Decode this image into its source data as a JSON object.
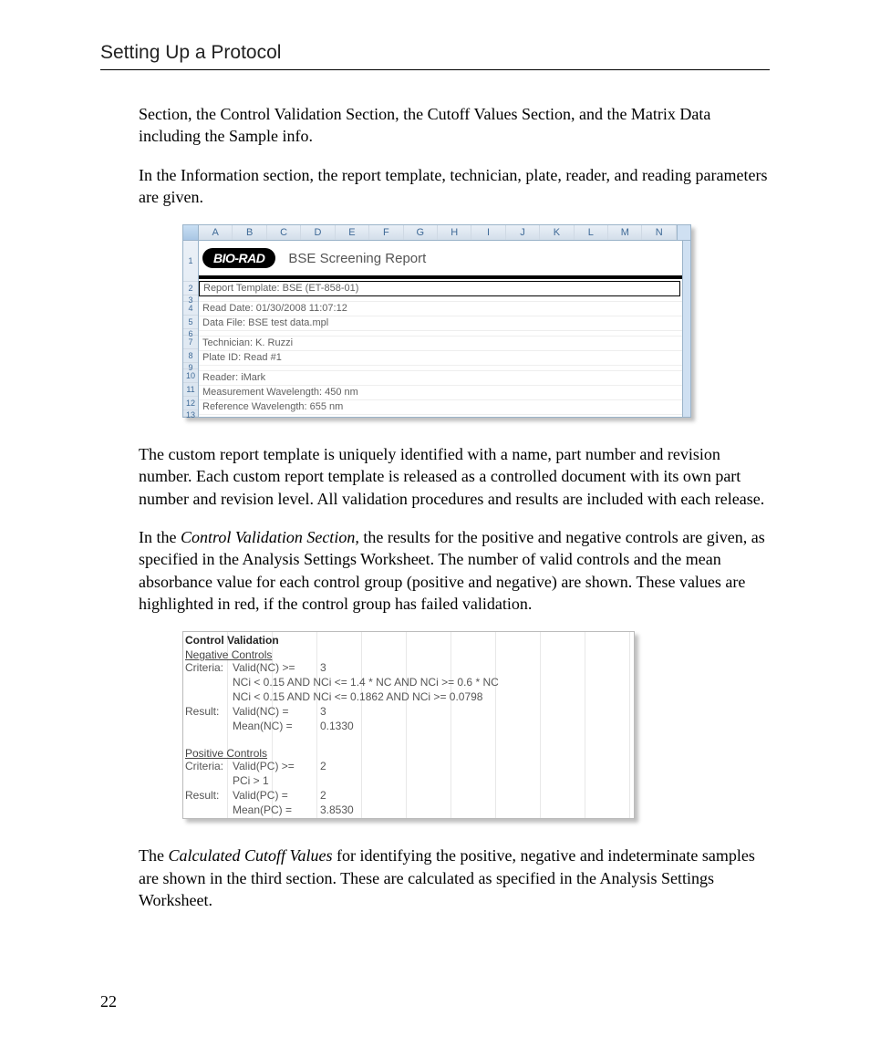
{
  "header": {
    "title": "Setting Up a Protocol"
  },
  "paras": {
    "p1": "Section, the Control Validation Section, the Cutoff Values Section, and the Matrix Data including the Sample info.",
    "p2": "In the Information section, the report template, technician, plate, reader, and reading parameters are given.",
    "p3": "The custom report template is uniquely identified with a name, part number and revision number. Each custom report template is released as a controlled document with its own part number and revision level. All validation procedures and results are included with each release.",
    "p4_a": "In the ",
    "p4_i": "Control Validation Section,",
    "p4_b": " the results for the positive and negative controls are given, as specified in the Analysis Settings Worksheet. The number of valid controls and the mean absorbance value for each control group (positive and negative) are shown. These values are highlighted in red, if the control group has failed validation.",
    "p5_a": "The ",
    "p5_i": "Calculated Cutoff Values",
    "p5_b": " for identifying the positive, negative and indeterminate samples are shown in the third section. These are calculated as specified in the Analysis Settings Worksheet."
  },
  "fig1": {
    "cols": [
      "A",
      "B",
      "C",
      "D",
      "E",
      "F",
      "G",
      "H",
      "I",
      "J",
      "K",
      "L",
      "M",
      "N"
    ],
    "rownums": [
      "1",
      "2",
      "3",
      "4",
      "5",
      "6",
      "7",
      "8",
      "9",
      "10",
      "11",
      "12",
      "13"
    ],
    "logo": "BIO-RAD",
    "title": "BSE Screening Report",
    "rows": {
      "r2": "Report Template: BSE (ET-858-01)",
      "r4": "Read Date: 01/30/2008 11:07:12",
      "r5": "Data File: BSE test data.mpl",
      "r7": "Technician: K. Ruzzi",
      "r8": "Plate ID: Read #1",
      "r10": "Reader: iMark",
      "r11": "Measurement Wavelength: 450 nm",
      "r12": "Reference Wavelength: 655 nm"
    }
  },
  "fig2": {
    "heading": "Control Validation",
    "neg": {
      "title": "Negative Controls",
      "criteria_label": "Criteria:",
      "c1_l": "Valid(NC) >=",
      "c1_v": "3",
      "c2": "NCi < 0.15 AND NCi <= 1.4 * NC AND NCi >= 0.6 * NC",
      "c3": "NCi < 0.15 AND NCi <= 0.1862 AND NCi >= 0.0798",
      "result_label": "Result:",
      "r1_l": "Valid(NC) =",
      "r1_v": "3",
      "r2_l": "Mean(NC) =",
      "r2_v": "0.1330"
    },
    "pos": {
      "title": "Positive Controls",
      "criteria_label": "Criteria:",
      "c1_l": "Valid(PC) >=",
      "c1_v": "2",
      "c2": "PCi > 1",
      "result_label": "Result:",
      "r1_l": "Valid(PC) =",
      "r1_v": "2",
      "r2_l": "Mean(PC) =",
      "r2_v": "3.8530"
    }
  },
  "page_number": "22"
}
